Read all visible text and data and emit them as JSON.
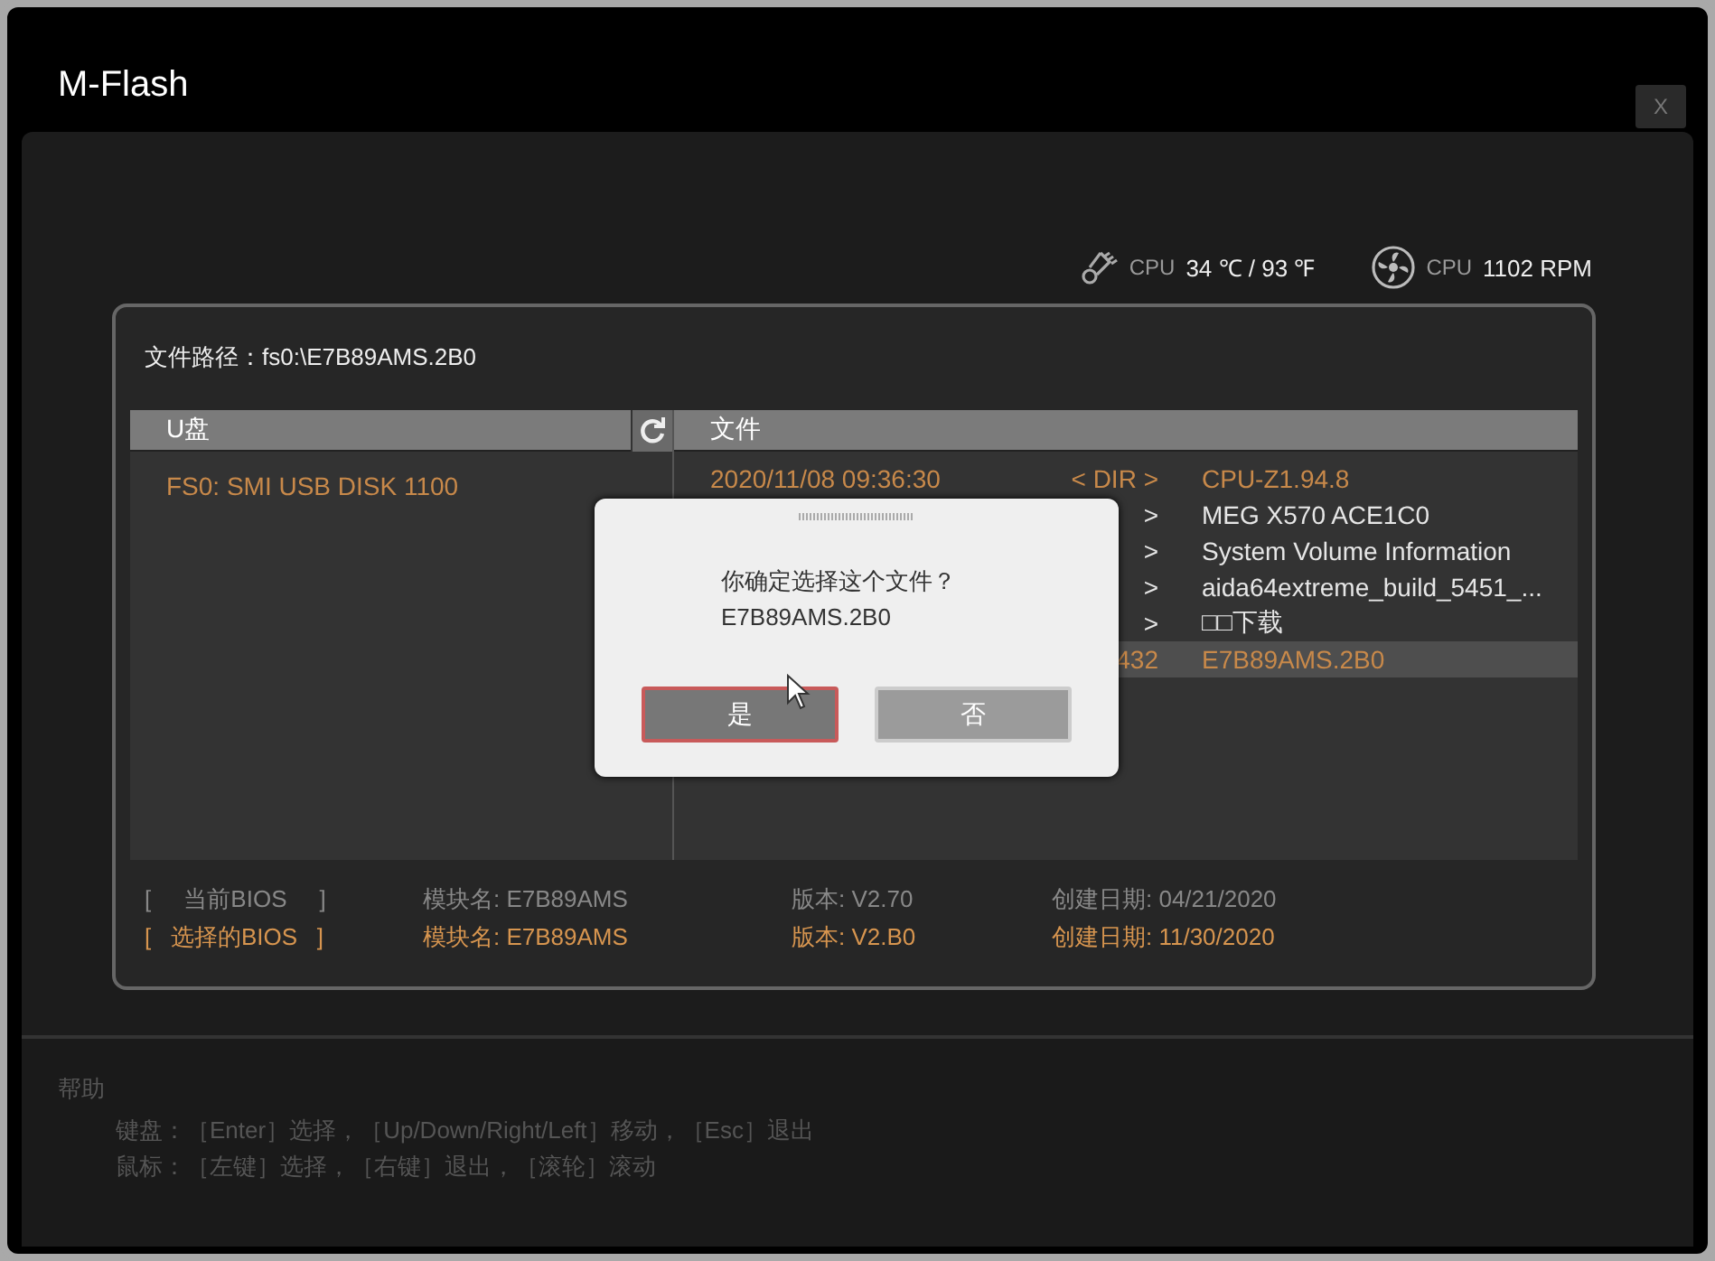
{
  "window": {
    "title": "M-Flash",
    "close": "X"
  },
  "sensors": [
    {
      "kind": "temperature",
      "label": "CPU",
      "reading": "34 ℃ / 93 ℉"
    },
    {
      "kind": "fan",
      "label": "CPU",
      "reading": "1102 RPM"
    }
  ],
  "file_path": "文件路径：fs0:\\E7B89AMS.2B0",
  "drives": {
    "heading": "U盘",
    "items": [
      {
        "name": "FS0: SMI USB DISK 1100",
        "selected": true
      }
    ]
  },
  "files": {
    "heading": "文件",
    "rows": [
      {
        "column_1": "2020/11/08 09:36:30",
        "column_2": "< DIR >",
        "column_3": "CPU-Z1.94.8",
        "color": "#c8894a",
        "selected": false
      },
      {
        "column_2": ">",
        "column_3": "MEG X570 ACE1C0",
        "color": "#e6e6e6",
        "selected": false
      },
      {
        "column_2": ">",
        "column_3": "System Volume Information",
        "color": "#e6e6e6",
        "selected": false
      },
      {
        "column_2": ">",
        "column_3": "aida64extreme_build_5451_...",
        "color": "#e6e6e6",
        "selected": false
      },
      {
        "column_2": ">",
        "column_3": "□□下载",
        "color": "#e6e6e6",
        "selected": false
      },
      {
        "column_2": "432",
        "column_3": "E7B89AMS.2B0",
        "color": "#c8894a",
        "selected": true
      }
    ]
  },
  "bios": [
    {
      "label": "[     当前BIOS     ]",
      "module": "模块名: E7B89AMS",
      "version": "版本: V2.70",
      "date": "创建日期: 04/21/2020",
      "selected": false
    },
    {
      "label": "[   选择的BIOS   ]",
      "module": "模块名: E7B89AMS",
      "version": "版本: V2.B0",
      "date": "创建日期: 11/30/2020",
      "selected": true
    }
  ],
  "dialog": {
    "message": "你确定选择这个文件？",
    "file": "E7B89AMS.2B0",
    "buttons": [
      {
        "label": "是",
        "selected": true
      },
      {
        "label": "否",
        "selected": false
      }
    ]
  },
  "help": {
    "title": "帮助",
    "lines": [
      "键盘：［Enter］选择，［Up/Down/Right/Left］移动，［Esc］退出",
      "鼠标：［左键］选择，［右键］退出，［滚轮］滚动"
    ]
  }
}
